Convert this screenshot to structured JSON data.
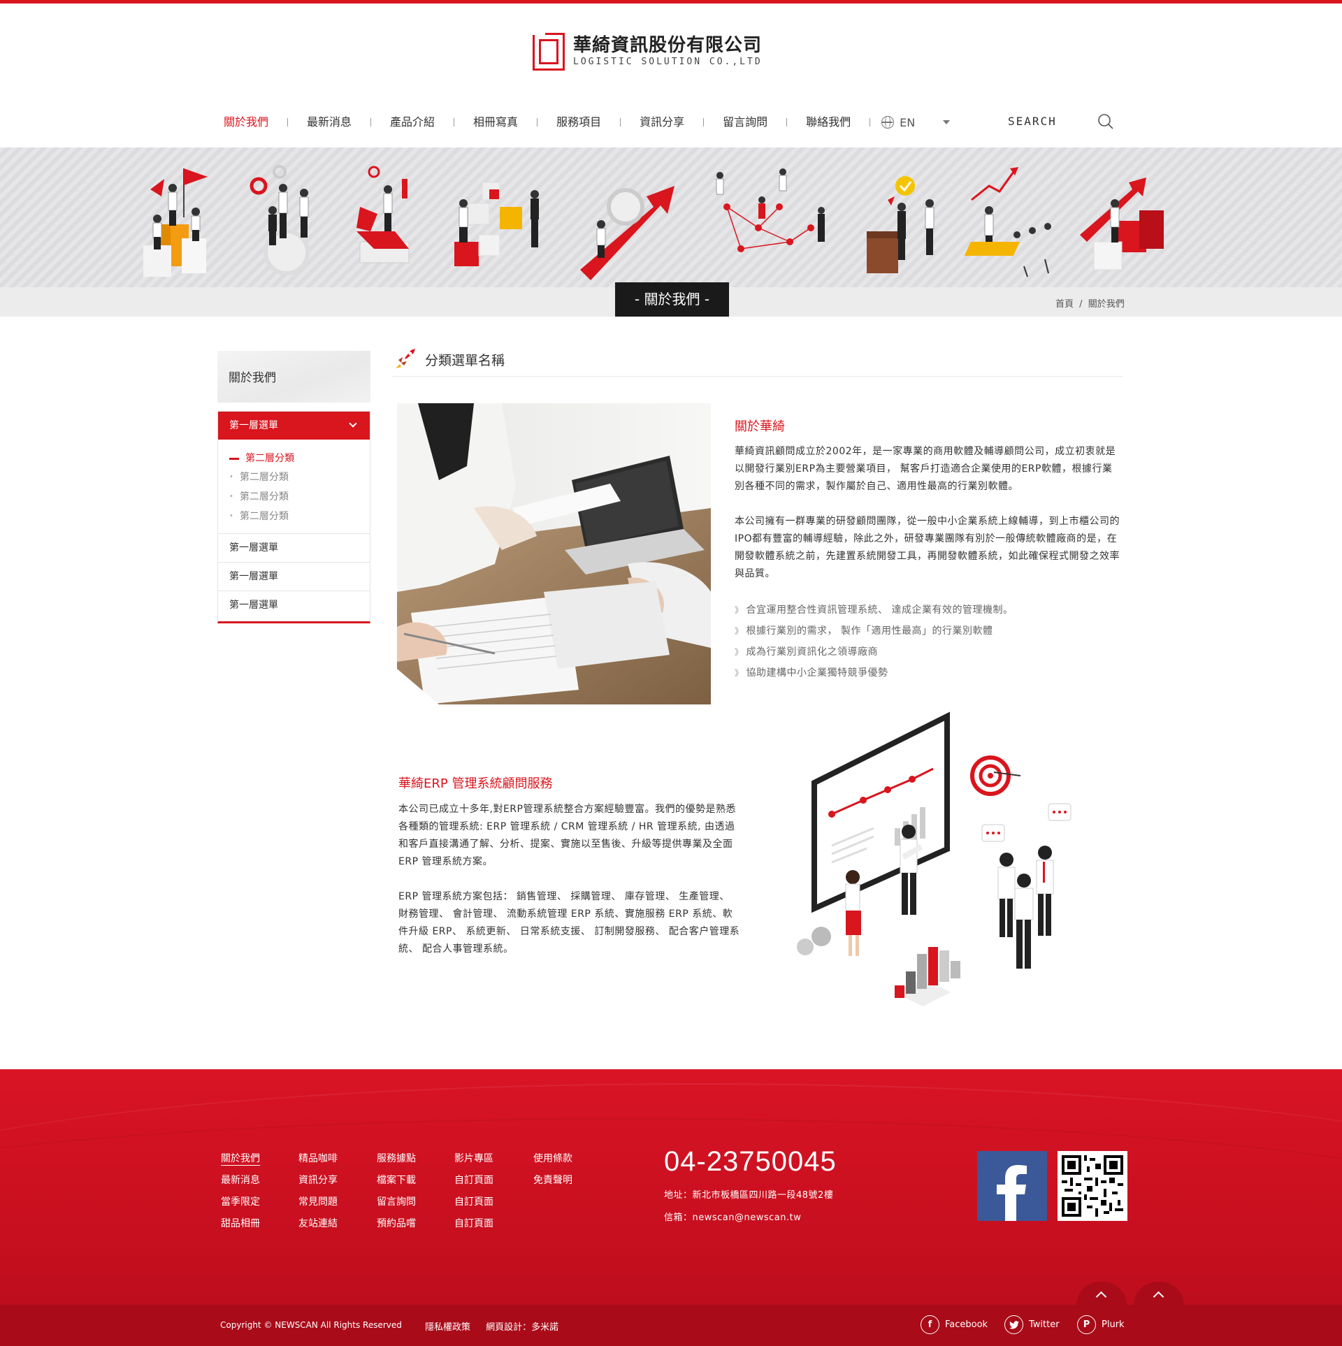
{
  "header": {
    "company_cn": "華綺資訊股份有限公司",
    "company_en": "LOGISTIC SOLUTION CO.,LTD"
  },
  "nav": {
    "items": [
      "關於我們",
      "最新消息",
      "產品介紹",
      "相冊寫真",
      "服務項目",
      "資訊分享",
      "留言詢問",
      "聯絡我們"
    ],
    "lang": "EN",
    "search_label": "SEARCH"
  },
  "banner": {
    "title": "- 關於我們 -",
    "breadcrumb_home": "首頁",
    "breadcrumb_sep": "/",
    "breadcrumb_current": "關於我們"
  },
  "sidebar": {
    "title": "關於我們",
    "active_l1": "第一層選單",
    "active_sub": "第二層分類",
    "subs": [
      "第二層分類",
      "第二層分類",
      "第二層分類"
    ],
    "l1_items": [
      "第一層選單",
      "第一層選單",
      "第一層選單"
    ]
  },
  "section": {
    "title": "分類選單名稱"
  },
  "about": {
    "title": "關於華綺",
    "p1": "華綺資訊顧問成立於2002年，是一家專業的商用軟體及輔導顧問公司，成立初衷就是以開發行業別ERP為主要營業項目， 幫客戶打造適合企業使用的ERP軟體，根據行業別各種不同的需求，製作屬於自己、適用性最高的行業別軟體。",
    "p2": "本公司擁有一群專業的研發顧問團隊，從一般中小企業系統上線輔導，到上市櫃公司的IPO都有豐富的輔導經驗，除此之外，研發專業團隊有別於一般傳統軟體廠商的是，在開發軟體系統之前，先建置系統開發工具，再開發軟體系統，如此確保程式開發之效率與品質。",
    "bullets": [
      "合宜運用整合性資訊管理系統、 達成企業有效的管理機制。",
      "根據行業別的需求， 製作「適用性最高」的行業別軟體",
      "成為行業別資訊化之領導廠商",
      "協助建構中小企業獨特競爭優勢"
    ]
  },
  "erp": {
    "title": "華綺ERP 管理系統顧問服務",
    "p1": "本公司已成立十多年,對ERP管理系統整合方案經驗豐富。我們的優勢是熟悉各種類的管理系統: ERP 管理系統 / CRM 管理系統 / HR 管理系統, 由透過和客戶直接溝通了解、分析、提案、實施以至售後、升級等提供專業及全面ERP 管理系統方案。",
    "p2": "ERP 管理系統方案包括： 銷售管理、 採購管理、 庫存管理、 生產管理、 財務管理、 會計管理、 流動系統管理 ERP 系統、實施服務 ERP 系統、軟件升級 ERP、 系統更新、 日常系統支援、 訂制開發服務、 配合客户管理系統、 配合人事管理系統。"
  },
  "footer": {
    "col1": [
      "關於我們",
      "最新消息",
      "當季限定",
      "甜品相冊"
    ],
    "col2": [
      "精品咖啡",
      "資訊分享",
      "常見問題",
      "友站連結"
    ],
    "col3": [
      "服務據點",
      "檔案下載",
      "留言詢問",
      "預約品嚐"
    ],
    "col4": [
      "影片專區",
      "自訂頁面",
      "自訂頁面",
      "自訂頁面"
    ],
    "col5": [
      "使用條款",
      "免責聲明"
    ],
    "phone": "04-23750045",
    "address": "地址：新北市板橋區四川路一段48號2樓",
    "email": "信箱：newscan@newscan.tw",
    "copyright": "Copyright © NEWSCAN All Rights Reserved",
    "privacy": "隱私權政策",
    "design": "網頁設計：多米諾",
    "social": [
      "Facebook",
      "Twitter",
      "Plurk"
    ]
  },
  "colors": {
    "brand_red": "#d9151e",
    "footer_red": "#c70f1f",
    "dark": "#1a1a1a"
  }
}
